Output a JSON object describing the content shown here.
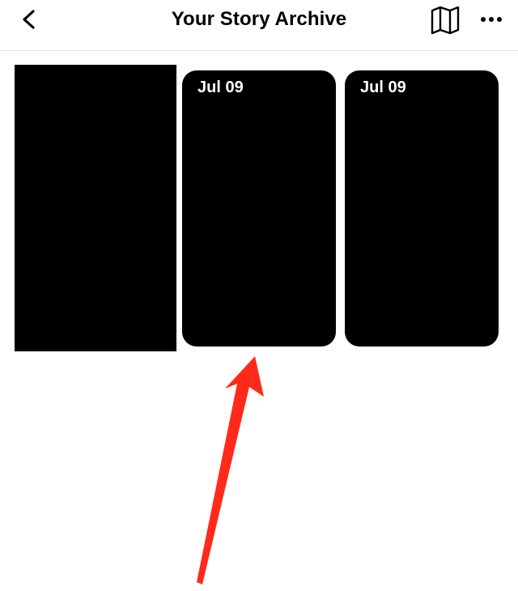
{
  "header": {
    "title": "Your Story Archive",
    "back_icon": "chevron-left-icon",
    "map_icon": "map-icon",
    "more_icon": "ellipsis-icon"
  },
  "archive": {
    "items": [
      {
        "date": ""
      },
      {
        "date": "Jul 09"
      },
      {
        "date": "Jul 09"
      }
    ]
  },
  "annotation": {
    "arrow_color": "#ff2a1a"
  }
}
